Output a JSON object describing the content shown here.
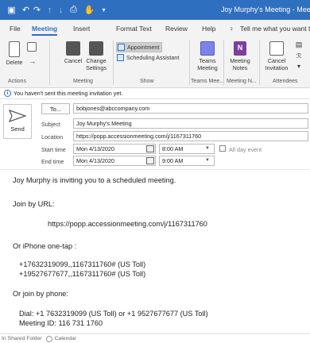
{
  "window": {
    "title": "Joy Murphy's Meeting - Meetin"
  },
  "quick_access": [
    {
      "name": "save-icon",
      "glyph": "▣"
    },
    {
      "name": "undo-icon",
      "glyph": "↶"
    },
    {
      "name": "redo-icon",
      "glyph": "↷"
    },
    {
      "name": "up-icon",
      "glyph": "↑"
    },
    {
      "name": "down-icon",
      "glyph": "↓"
    },
    {
      "name": "print-icon",
      "glyph": "⎙"
    },
    {
      "name": "touch-mode-icon",
      "glyph": "✋"
    },
    {
      "name": "customize-icon",
      "glyph": "▾"
    }
  ],
  "tabs": [
    "File",
    "Meeting",
    "Insert",
    "Format Text",
    "Review",
    "Help"
  ],
  "tell_me": "Tell me what you want t",
  "ribbon": {
    "delete": "Delete",
    "cancel": "Cancel",
    "change_settings": "Change Settings",
    "appointment": "Appointment",
    "scheduling_assistant": "Scheduling Assistant",
    "teams_meeting": "Teams Meeting",
    "meeting_notes": "Meeting Notes",
    "cancel_invitation": "Cancel Invitation",
    "groups": {
      "actions": "Actions",
      "meeting": "Meeting",
      "show": "Show",
      "teams": "Teams Mee...",
      "meeting_notes": "Meeting N...",
      "attendees": "Attendees"
    }
  },
  "info_bar": "You haven't sent this meeting invitation yet.",
  "form": {
    "send": "Send",
    "to_button": "To...",
    "to_value": "bobjones@abccompany.com",
    "subject_label": "Subject",
    "subject_value": "Joy Murphy's Meeting",
    "location_label": "Location",
    "location_value": "https://popp.accessionmeeting.com/j/1167311760",
    "start_label": "Start time",
    "start_date": "Mon 4/13/2020",
    "start_time": "8:00 AM",
    "all_day": "All day event",
    "end_label": "End time",
    "end_date": "Mon 4/13/2020",
    "end_time": "9:00 AM"
  },
  "body": {
    "line1": "Joy Murphy is inviting you to a scheduled meeting.",
    "line2": "Join by URL:",
    "line3": "https://popp.accessionmeeting.com/j/1167311760",
    "line4": "Or iPhone one-tap :",
    "line5": "+17632319099,,1167311760# (US Toll)",
    "line6": "+19527677677,,1167311760# (US Toll)",
    "line7": "Or join by phone:",
    "line8": "Dial: +1 7632319099 (US Toll) or +1 9527677677 (US Toll)",
    "line9": "Meeting ID: 116 731 1760"
  },
  "status": {
    "folder": "In Shared Folder",
    "calendar": "Calendar"
  },
  "colors": {
    "brand": "#2f6fc0",
    "ribbon_bg": "#f3f3f3"
  }
}
